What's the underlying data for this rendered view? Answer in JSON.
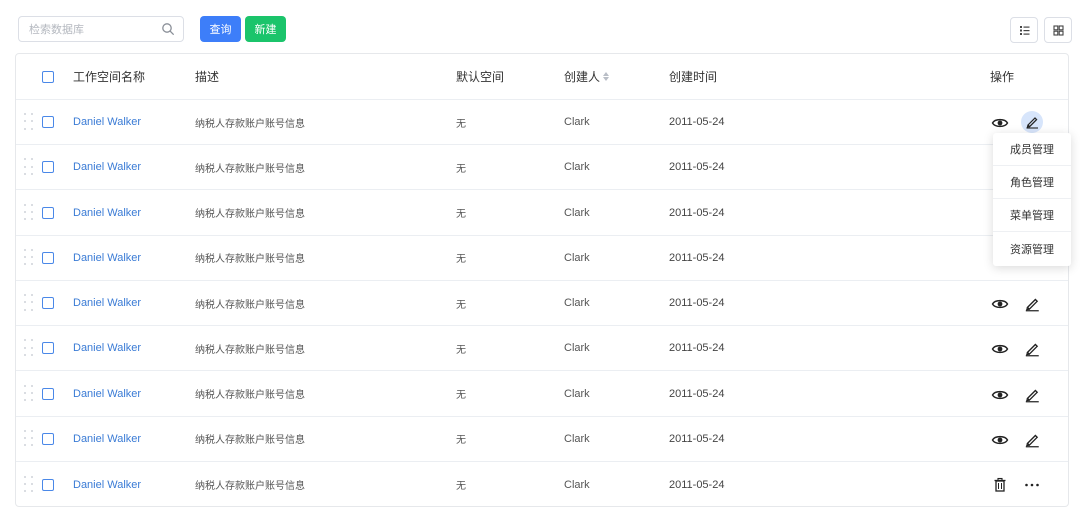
{
  "toolbar": {
    "search_placeholder": "检索数据库",
    "query_label": "查询",
    "new_label": "新建"
  },
  "table": {
    "columns": {
      "name": "工作空间名称",
      "desc": "描述",
      "default": "默认空间",
      "creator": "创建人",
      "time": "创建时间",
      "ops": "操作"
    },
    "rows": [
      {
        "name": "Daniel Walker",
        "desc": "纳税人存款账户账号信息",
        "default": "无",
        "creator": "Clark",
        "time": "2011-05-24"
      },
      {
        "name": "Daniel Walker",
        "desc": "纳税人存款账户账号信息",
        "default": "无",
        "creator": "Clark",
        "time": "2011-05-24"
      },
      {
        "name": "Daniel Walker",
        "desc": "纳税人存款账户账号信息",
        "default": "无",
        "creator": "Clark",
        "time": "2011-05-24"
      },
      {
        "name": "Daniel Walker",
        "desc": "纳税人存款账户账号信息",
        "default": "无",
        "creator": "Clark",
        "time": "2011-05-24"
      },
      {
        "name": "Daniel Walker",
        "desc": "纳税人存款账户账号信息",
        "default": "无",
        "creator": "Clark",
        "time": "2011-05-24"
      },
      {
        "name": "Daniel Walker",
        "desc": "纳税人存款账户账号信息",
        "default": "无",
        "creator": "Clark",
        "time": "2011-05-24"
      },
      {
        "name": "Daniel Walker",
        "desc": "纳税人存款账户账号信息",
        "default": "无",
        "creator": "Clark",
        "time": "2011-05-24"
      },
      {
        "name": "Daniel Walker",
        "desc": "纳税人存款账户账号信息",
        "default": "无",
        "creator": "Clark",
        "time": "2011-05-24"
      },
      {
        "name": "Daniel Walker",
        "desc": "纳税人存款账户账号信息",
        "default": "无",
        "creator": "Clark",
        "time": "2011-05-24"
      }
    ]
  },
  "dropdown": {
    "items": [
      "成员管理",
      "角色管理",
      "菜单管理",
      "资源管理"
    ]
  },
  "icons": {
    "search": "search-icon",
    "list_view": "list-view-icon",
    "grid_view": "grid-view-icon",
    "view": "eye-icon",
    "edit": "edit-icon",
    "delete": "trash-icon",
    "more": "more-icon"
  },
  "colors": {
    "primary": "#3d7ef9",
    "success": "#1bc46b",
    "link": "#3a7bd5",
    "active_bg": "#d7e5fb"
  }
}
